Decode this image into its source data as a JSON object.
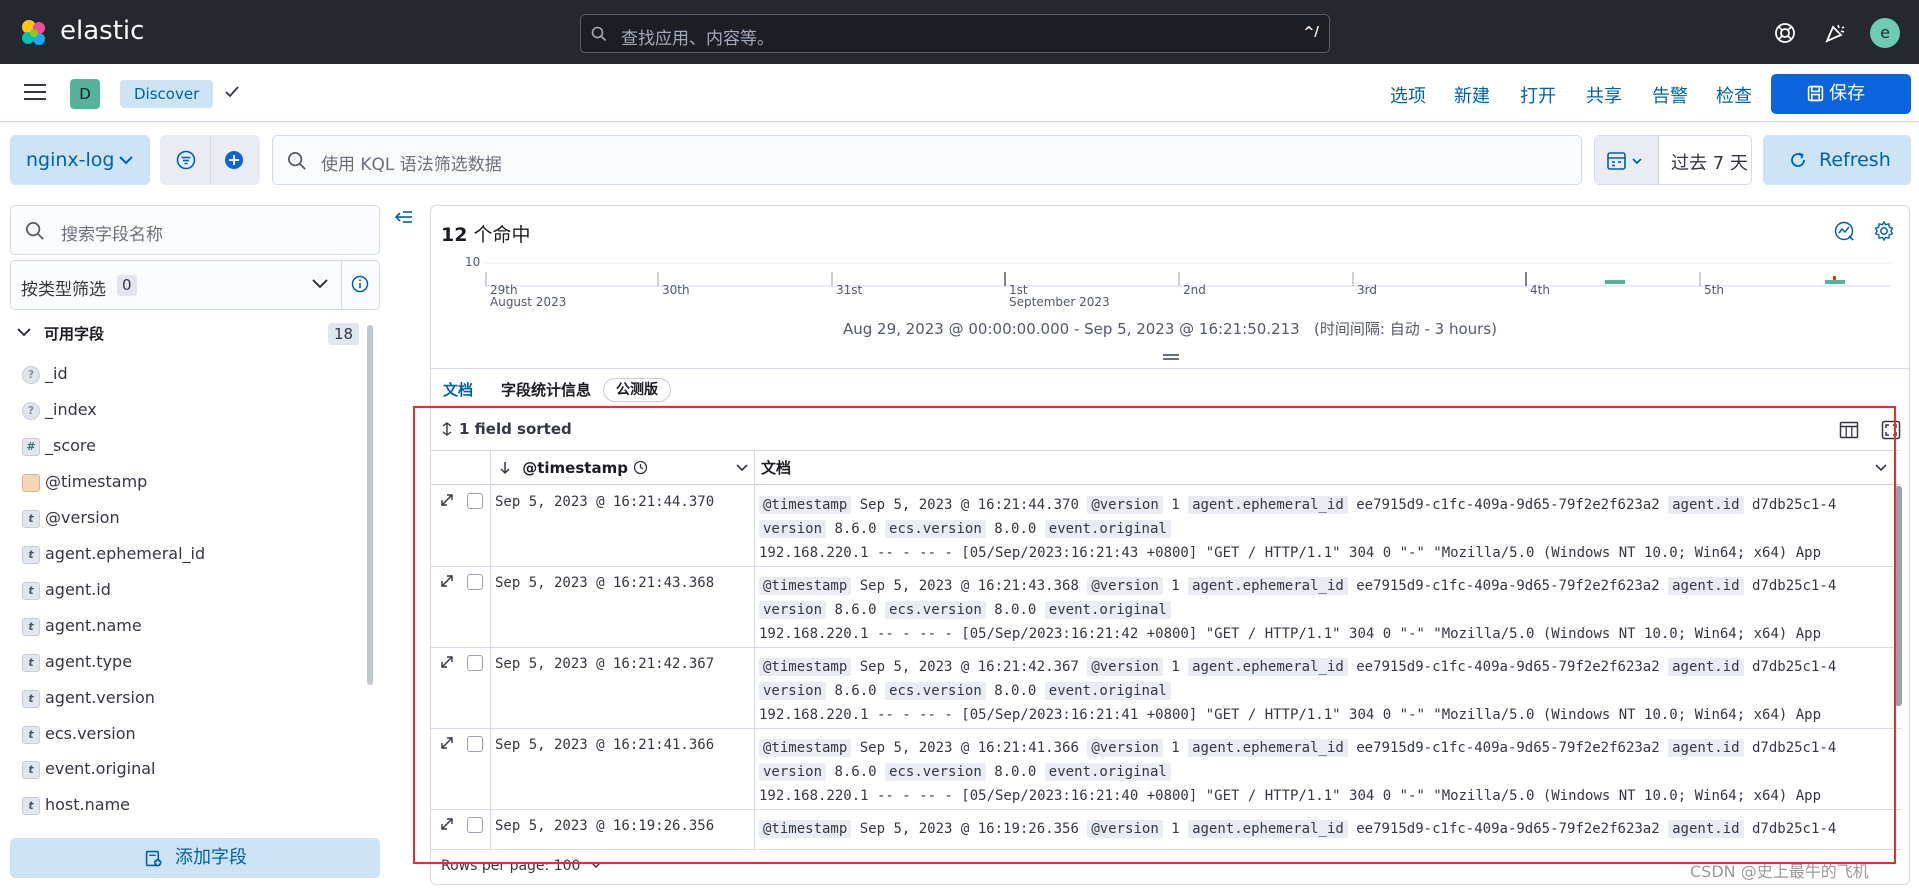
{
  "header": {
    "brand": "elastic",
    "search_placeholder": "查找应用、内容等。",
    "search_shortcut": "^/",
    "user_initial": "e"
  },
  "appbar": {
    "space_initial": "D",
    "breadcrumb": "Discover",
    "links": [
      "选项",
      "新建",
      "打开",
      "共享",
      "告警",
      "检查"
    ],
    "save_label": "保存"
  },
  "querybar": {
    "data_view": "nginx-log",
    "kql_placeholder": "使用 KQL 语法筛选数据",
    "time_range": "过去 7 天",
    "refresh_label": "Refresh"
  },
  "sidebar": {
    "search_placeholder": "搜索字段名称",
    "type_filter_label": "按类型筛选",
    "type_filter_count": "0",
    "available_label": "可用字段",
    "available_count": "18",
    "fields": [
      {
        "type": "?",
        "name": "_id"
      },
      {
        "type": "?",
        "name": "_index"
      },
      {
        "type": "#",
        "name": "_score"
      },
      {
        "type": "date",
        "name": "@timestamp"
      },
      {
        "type": "t",
        "name": "@version"
      },
      {
        "type": "t",
        "name": "agent.ephemeral_id"
      },
      {
        "type": "t",
        "name": "agent.id"
      },
      {
        "type": "t",
        "name": "agent.name"
      },
      {
        "type": "t",
        "name": "agent.type"
      },
      {
        "type": "t",
        "name": "agent.version"
      },
      {
        "type": "t",
        "name": "ecs.version"
      },
      {
        "type": "t",
        "name": "event.original"
      },
      {
        "type": "t",
        "name": "host.name"
      }
    ],
    "add_field_label": "添加字段"
  },
  "main": {
    "hits_count": "12",
    "hits_suffix": " 个命中",
    "histogram": {
      "y_tick": "10",
      "day_labels": [
        "29th",
        "30th",
        "31st",
        "1st",
        "2nd",
        "3rd",
        "4th",
        "5th"
      ],
      "month_labels": [
        "August 2023",
        "September 2023"
      ]
    },
    "time_range_text": "Aug 29, 2023 @ 00:00:00.000 - Sep 5, 2023 @ 16:21:50.213",
    "interval_text": "(时间间隔: 自动 - 3 hours)",
    "tabs": [
      "文档",
      "字段统计信息"
    ],
    "beta_label": "公测版",
    "sort_info": "1 field sorted",
    "columns": {
      "timestamp": "@timestamp",
      "document": "文档"
    },
    "rows": [
      {
        "ts": "Sep 5, 2023 @ 16:21:44.370",
        "line1_v1": "Sep 5, 2023 @ 16:21:44.370",
        "line1_v2": "1",
        "line1_v3": "ee7915d9-c1fc-409a-9d65-79f2e2f623a2",
        "line1_v4": "d7db25c1-4",
        "line2_v1": "8.6.0",
        "line2_v2": "8.0.0",
        "line3": "192.168.220.1 -- - -- - [05/Sep/2023:16:21:43 +0800] \"GET / HTTP/1.1\" 304 0 \"-\" \"Mozilla/5.0 (Windows NT 10.0; Win64; x64) App"
      },
      {
        "ts": "Sep 5, 2023 @ 16:21:43.368",
        "line1_v1": "Sep 5, 2023 @ 16:21:43.368",
        "line1_v2": "1",
        "line1_v3": "ee7915d9-c1fc-409a-9d65-79f2e2f623a2",
        "line1_v4": "d7db25c1-4",
        "line2_v1": "8.6.0",
        "line2_v2": "8.0.0",
        "line3": "192.168.220.1 -- - -- - [05/Sep/2023:16:21:42 +0800] \"GET / HTTP/1.1\" 304 0 \"-\" \"Mozilla/5.0 (Windows NT 10.0; Win64; x64) App"
      },
      {
        "ts": "Sep 5, 2023 @ 16:21:42.367",
        "line1_v1": "Sep 5, 2023 @ 16:21:42.367",
        "line1_v2": "1",
        "line1_v3": "ee7915d9-c1fc-409a-9d65-79f2e2f623a2",
        "line1_v4": "d7db25c1-4",
        "line2_v1": "8.6.0",
        "line2_v2": "8.0.0",
        "line3": "192.168.220.1 -- - -- - [05/Sep/2023:16:21:41 +0800] \"GET / HTTP/1.1\" 304 0 \"-\" \"Mozilla/5.0 (Windows NT 10.0; Win64; x64) App"
      },
      {
        "ts": "Sep 5, 2023 @ 16:21:41.366",
        "line1_v1": "Sep 5, 2023 @ 16:21:41.366",
        "line1_v2": "1",
        "line1_v3": "ee7915d9-c1fc-409a-9d65-79f2e2f623a2",
        "line1_v4": "d7db25c1-4",
        "line2_v1": "8.6.0",
        "line2_v2": "8.0.0",
        "line3": "192.168.220.1 -- - -- - [05/Sep/2023:16:21:40 +0800] \"GET / HTTP/1.1\" 304 0 \"-\" \"Mozilla/5.0 (Windows NT 10.0; Win64; x64) App"
      },
      {
        "ts": "Sep 5, 2023 @ 16:19:26.356",
        "line1_v1": "Sep 5, 2023 @ 16:19:26.356",
        "line1_v2": "1",
        "line1_v3": "ee7915d9-c1fc-409a-9d65-79f2e2f623a2",
        "line1_v4": "d7db25c1-4",
        "line2_v1": "",
        "line2_v2": "",
        "line3": ""
      }
    ],
    "doc_keys": {
      "timestamp": "@timestamp",
      "version": "@version",
      "ephemeral": "agent.ephemeral_id",
      "agent_id": "agent.id",
      "version_tail": "version",
      "ecs": "ecs.version",
      "event": "event.original"
    },
    "rows_per_page": "Rows per page: 100"
  },
  "watermark": "CSDN @史上最牛的飞机",
  "colors": {
    "header_bg": "#25282f",
    "primary": "#0b64dd",
    "link": "#0061a6",
    "annotation": "#e03030"
  }
}
